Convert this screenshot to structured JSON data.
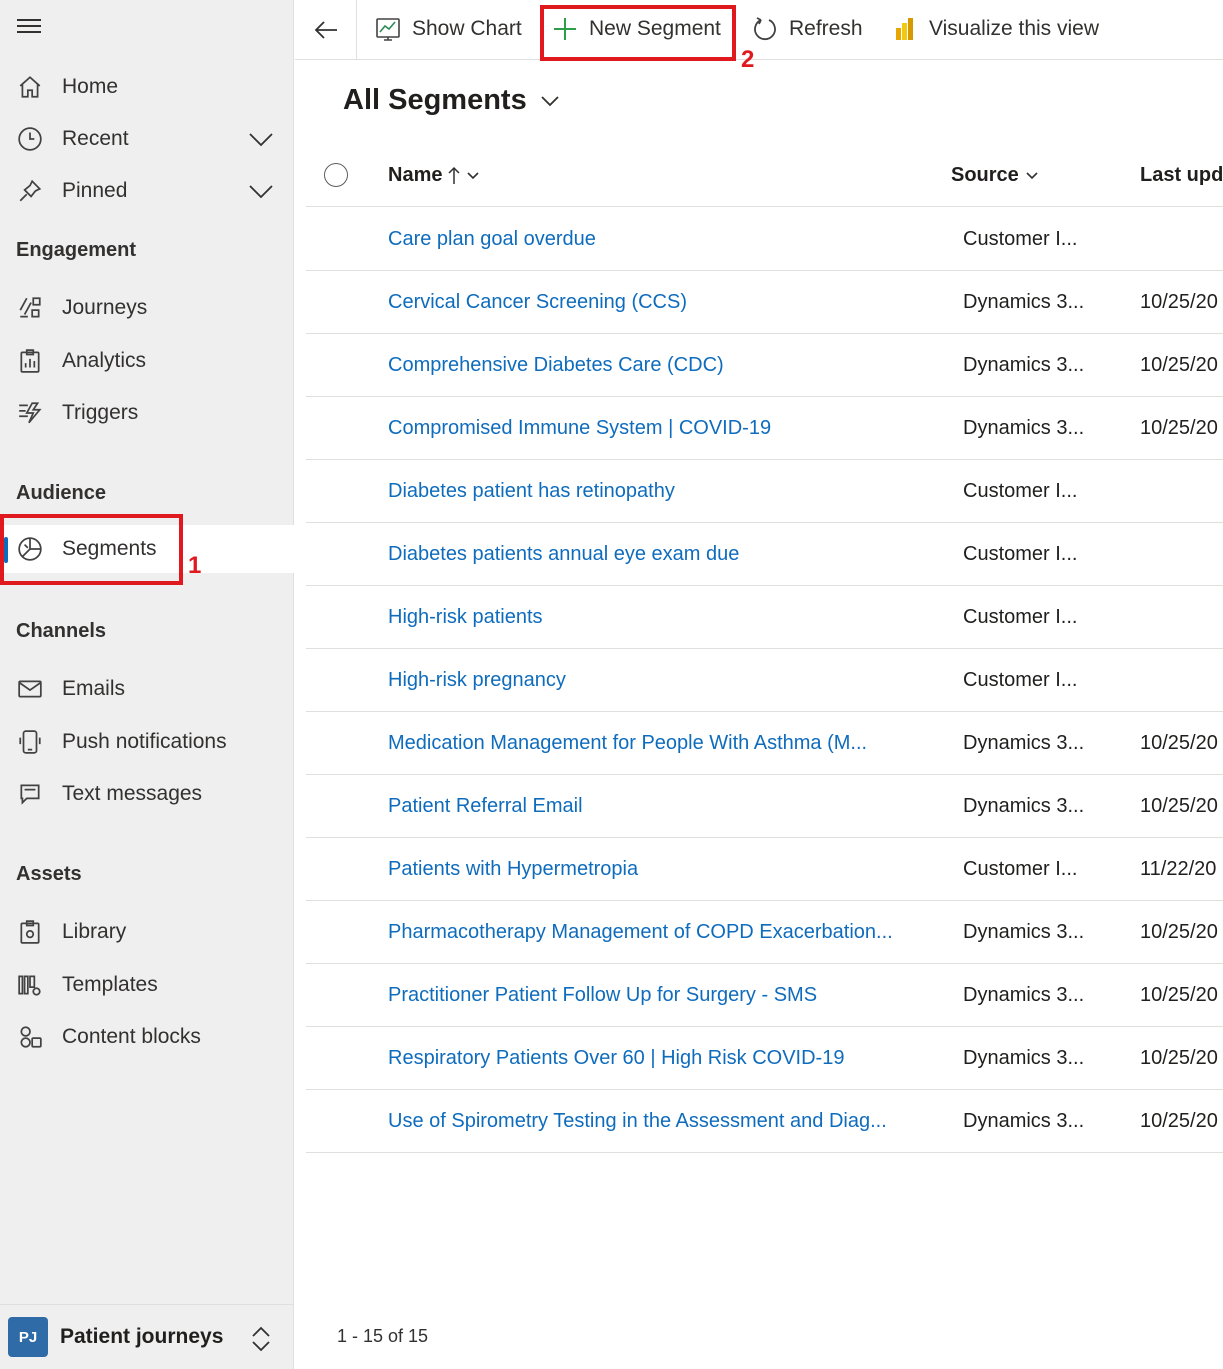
{
  "sidebar": {
    "top_items": [
      {
        "label": "Home",
        "icon": "home-icon"
      },
      {
        "label": "Recent",
        "icon": "clock-icon"
      },
      {
        "label": "Pinned",
        "icon": "pin-icon"
      }
    ],
    "sections": {
      "engagement": {
        "title": "Engagement",
        "items": [
          {
            "label": "Journeys",
            "icon": "journeys-icon"
          },
          {
            "label": "Analytics",
            "icon": "analytics-icon"
          },
          {
            "label": "Triggers",
            "icon": "triggers-icon"
          }
        ]
      },
      "audience": {
        "title": "Audience",
        "items": [
          {
            "label": "Segments",
            "icon": "segments-icon",
            "selected": true
          }
        ]
      },
      "channels": {
        "title": "Channels",
        "items": [
          {
            "label": "Emails",
            "icon": "mail-icon"
          },
          {
            "label": "Push notifications",
            "icon": "phone-icon"
          },
          {
            "label": "Text messages",
            "icon": "chat-icon"
          }
        ]
      },
      "assets": {
        "title": "Assets",
        "items": [
          {
            "label": "Library",
            "icon": "library-icon"
          },
          {
            "label": "Templates",
            "icon": "templates-icon"
          },
          {
            "label": "Content blocks",
            "icon": "content-blocks-icon"
          }
        ]
      }
    },
    "area": {
      "badge": "PJ",
      "label": "Patient journeys"
    }
  },
  "annotations": {
    "first": "1",
    "second": "2"
  },
  "toolbar": {
    "show_chart": "Show Chart",
    "new_segment": "New Segment",
    "refresh": "Refresh",
    "visualize": "Visualize this view"
  },
  "view": {
    "title": "All Segments"
  },
  "grid": {
    "columns": {
      "name": "Name",
      "source": "Source",
      "updated": "Last upda"
    },
    "rows": [
      {
        "name": "Care plan goal overdue",
        "source": "Customer I...",
        "updated": ""
      },
      {
        "name": "Cervical Cancer Screening (CCS)",
        "source": "Dynamics 3...",
        "updated": "10/25/20"
      },
      {
        "name": "Comprehensive Diabetes Care (CDC)",
        "source": "Dynamics 3...",
        "updated": "10/25/20"
      },
      {
        "name": "Compromised Immune System | COVID-19",
        "source": "Dynamics 3...",
        "updated": "10/25/20"
      },
      {
        "name": "Diabetes patient has retinopathy",
        "source": "Customer I...",
        "updated": ""
      },
      {
        "name": "Diabetes patients annual eye exam due",
        "source": "Customer I...",
        "updated": ""
      },
      {
        "name": "High-risk patients",
        "source": "Customer I...",
        "updated": ""
      },
      {
        "name": "High-risk pregnancy",
        "source": "Customer I...",
        "updated": ""
      },
      {
        "name": "Medication Management for People With Asthma (M...",
        "source": "Dynamics 3...",
        "updated": "10/25/20"
      },
      {
        "name": "Patient Referral Email",
        "source": "Dynamics 3...",
        "updated": "10/25/20"
      },
      {
        "name": "Patients with Hypermetropia",
        "source": "Customer I...",
        "updated": "11/22/20"
      },
      {
        "name": "Pharmacotherapy Management of COPD Exacerbation...",
        "source": "Dynamics 3...",
        "updated": "10/25/20"
      },
      {
        "name": "Practitioner Patient Follow Up for Surgery - SMS",
        "source": "Dynamics 3...",
        "updated": "10/25/20"
      },
      {
        "name": "Respiratory Patients Over 60 | High Risk COVID-19",
        "source": "Dynamics 3...",
        "updated": "10/25/20"
      },
      {
        "name": "Use of Spirometry Testing in the Assessment and Diag...",
        "source": "Dynamics 3...",
        "updated": "10/25/20"
      }
    ],
    "footer": "1 - 15 of 15"
  },
  "colors": {
    "accent": "#0f6cbd",
    "annotation": "#e0191f",
    "sidebar_bg": "#efefef"
  }
}
